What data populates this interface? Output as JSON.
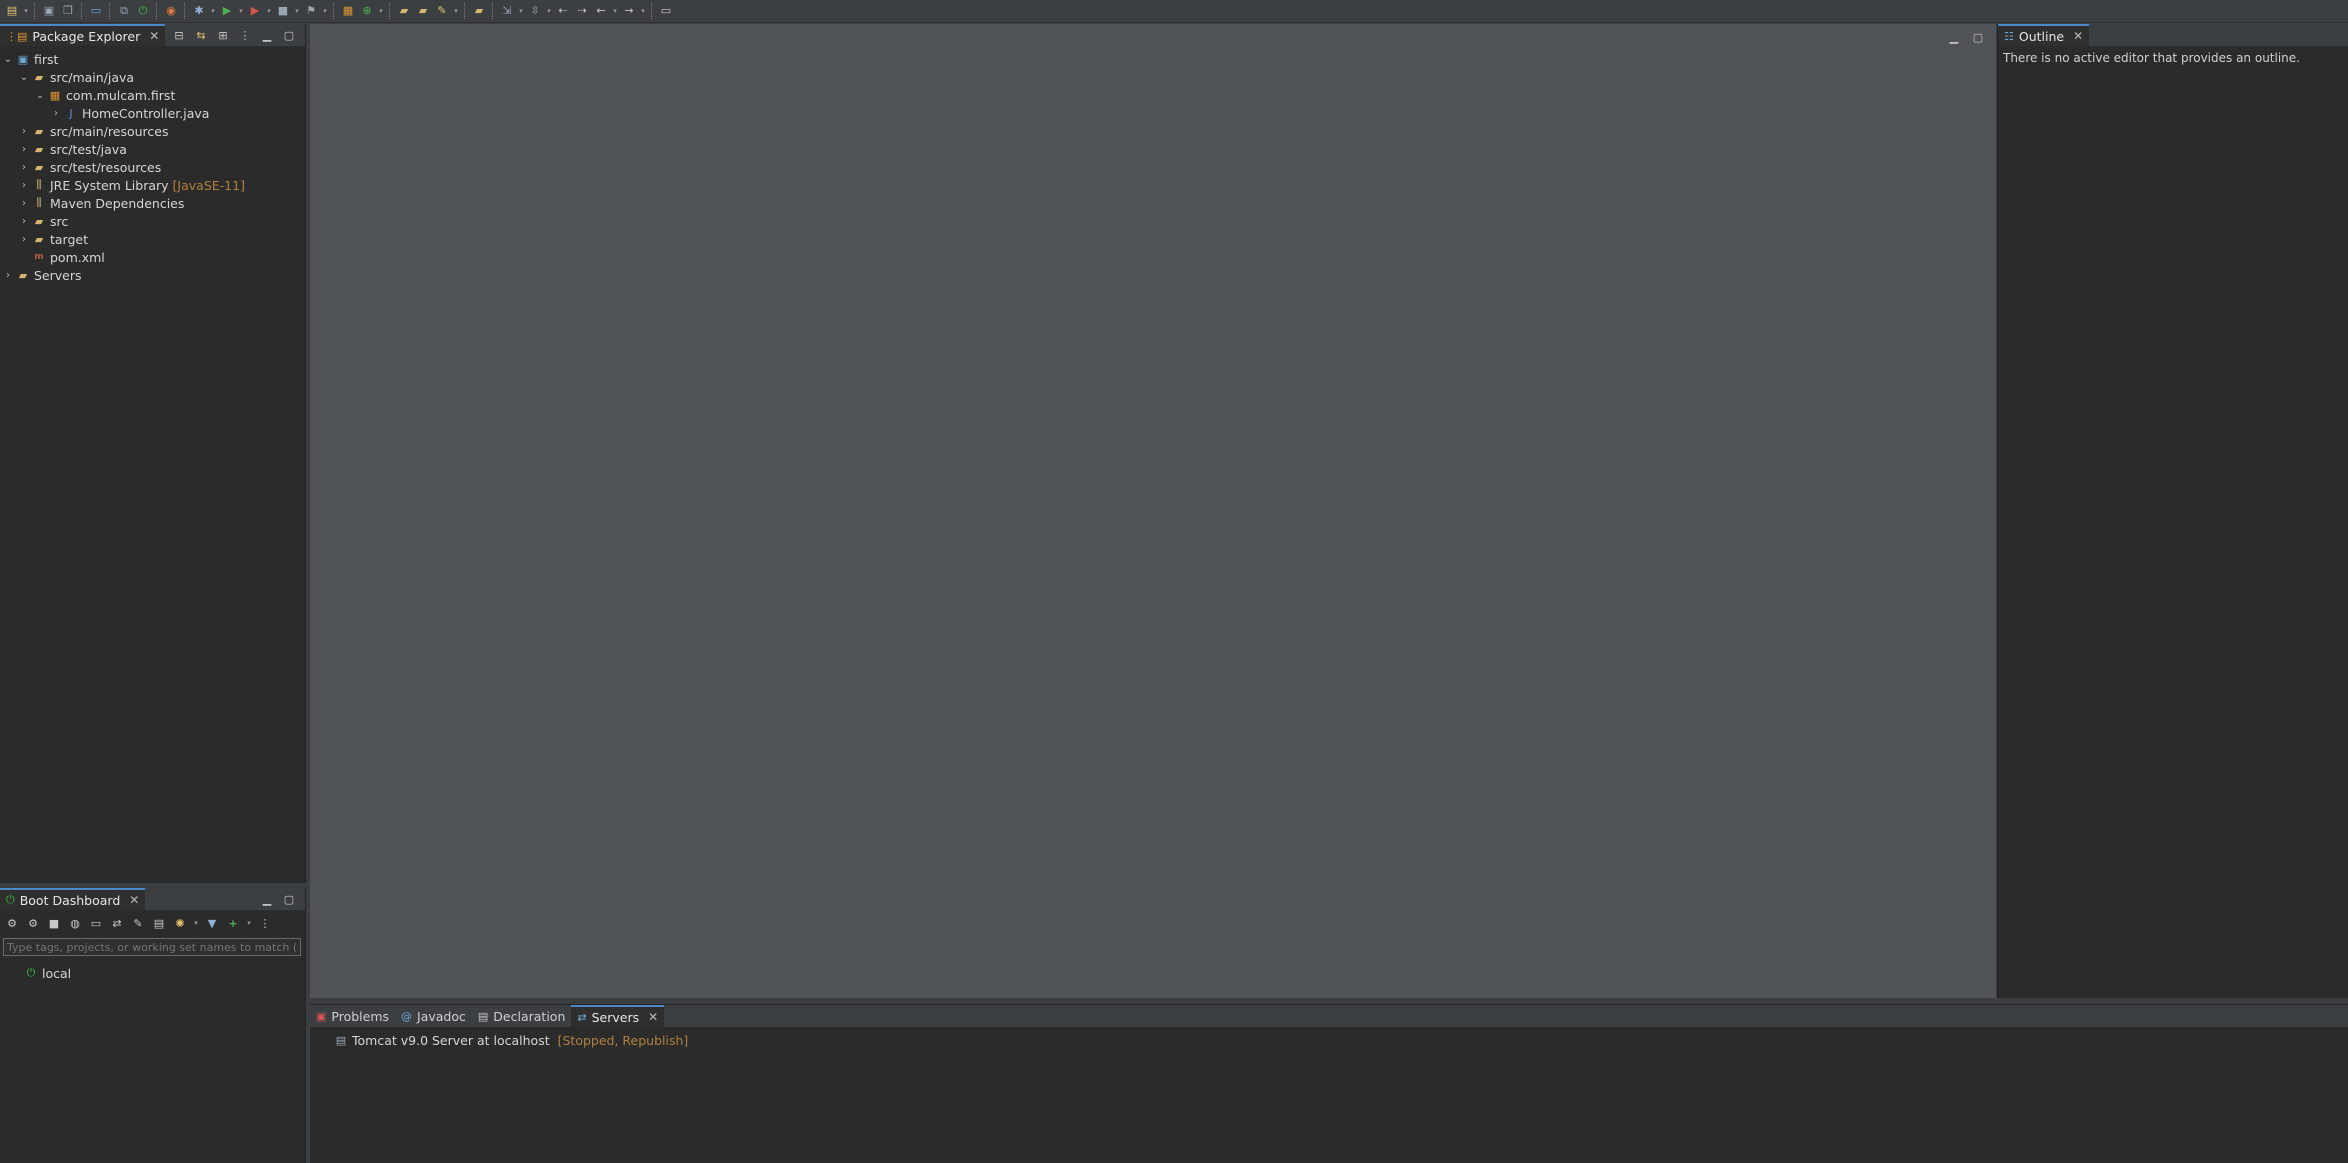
{
  "colors": {
    "accent": "#4a88c7",
    "decoration": "#b08040",
    "server_status": "#b08040",
    "boot_green": "#3fbf3f"
  },
  "toolbar": {
    "icons": [
      "new-icon",
      "save-icon",
      "save-all-icon",
      "terminal-icon",
      "skip-icon",
      "spring-boot-icon",
      "spring-relaunch-icon",
      "debug-icon",
      "run-icon",
      "coverage-icon",
      "stop-icon",
      "external-tools-icon",
      "new-package-icon",
      "new-class-icon",
      "open-type-icon",
      "open-task-icon",
      "search-icon",
      "open-folder-icon",
      "annotation-icon",
      "next-annotation-icon",
      "back-icon",
      "forward-icon",
      "last-edit-icon",
      "nav-forward-icon",
      "pin-icon"
    ]
  },
  "package_explorer": {
    "tab_label": "Package Explorer",
    "tree": {
      "project": "first",
      "src_main_java": "src/main/java",
      "package": "com.mulcam.first",
      "java_file": "HomeController.java",
      "src_main_resources": "src/main/resources",
      "src_test_java": "src/test/java",
      "src_test_resources": "src/test/resources",
      "jre_library": "JRE System Library",
      "jre_decoration": "[JavaSE-11]",
      "maven_deps": "Maven Dependencies",
      "src": "src",
      "target": "target",
      "pom": "pom.xml",
      "servers": "Servers"
    }
  },
  "outline": {
    "tab_label": "Outline",
    "message": "There is no active editor that provides an outline."
  },
  "boot_dashboard": {
    "tab_label": "Boot Dashboard",
    "filter_placeholder": "Type tags, projects, or working set names to match (in",
    "local_label": "local"
  },
  "bottom_panel": {
    "tabs": {
      "problems": "Problems",
      "javadoc": "Javadoc",
      "declaration": "Declaration",
      "servers": "Servers"
    },
    "server_name": "Tomcat v9.0 Server at localhost",
    "server_status": "[Stopped, Republish]"
  }
}
